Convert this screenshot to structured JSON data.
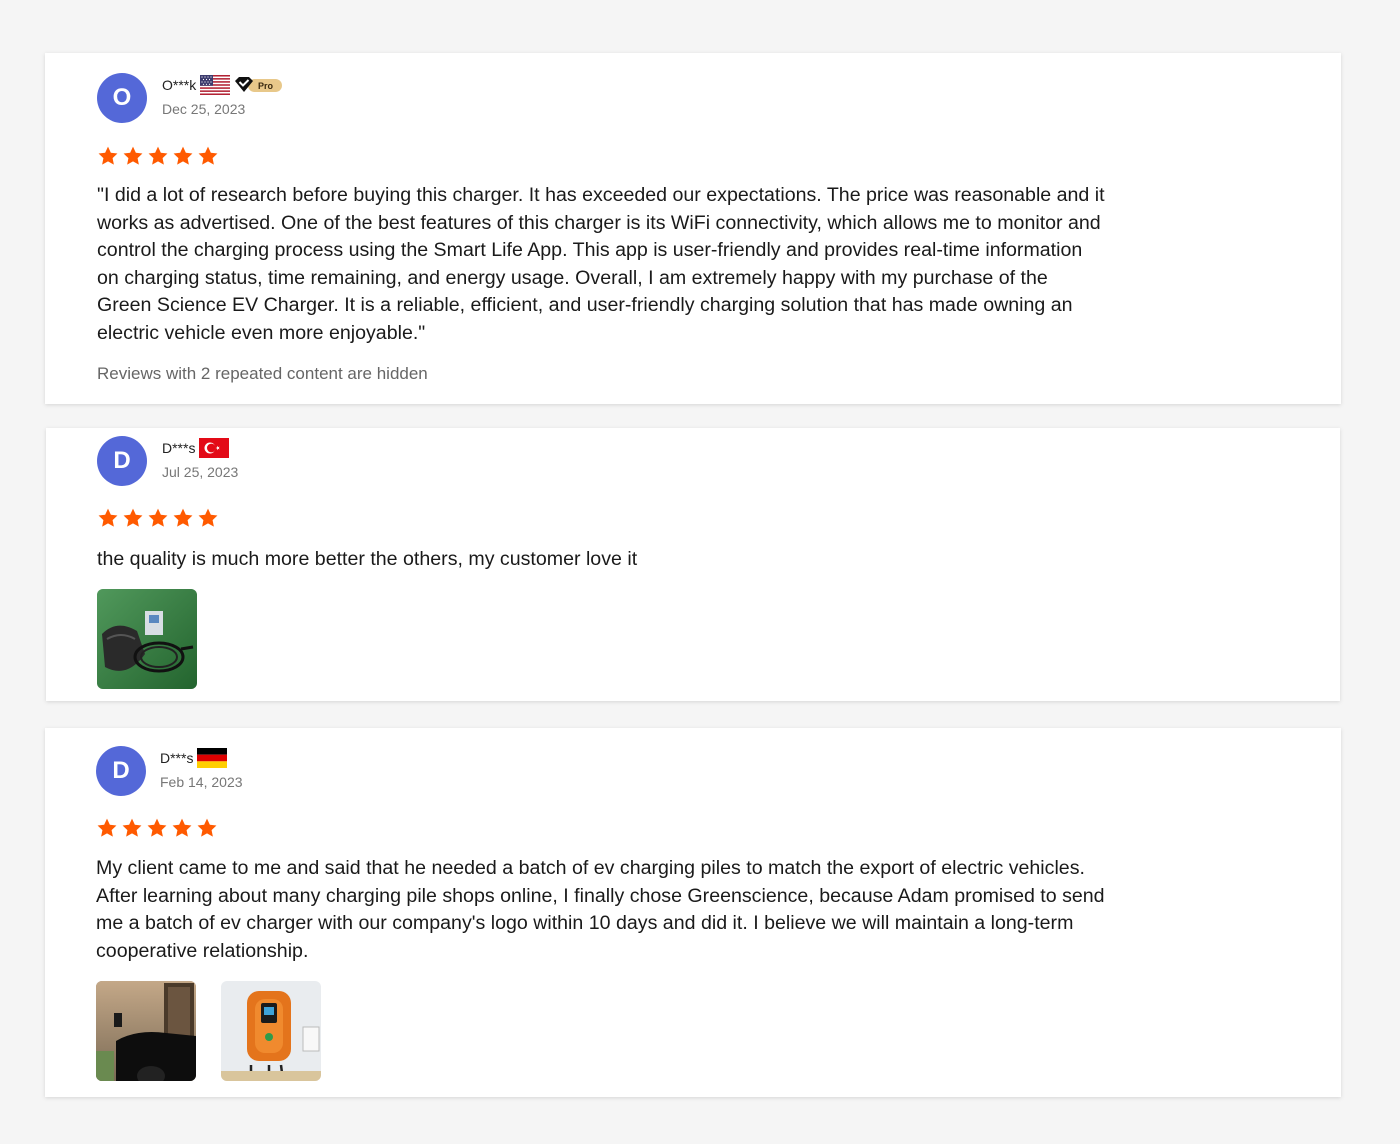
{
  "reviews": [
    {
      "initial": "O",
      "name": "O***k",
      "country_flag": "us-flag-icon",
      "badge": "Pro",
      "date": "Dec 25, 2023",
      "rating": 5,
      "text": "\"I did a lot of research before buying this charger. It has exceeded our expectations. The price was reasonable and it works as advertised. One of the best features of this charger is its WiFi connectivity, which allows me to monitor and control the charging process using the Smart Life App. This app is user-friendly and provides real-time information on charging status, time remaining, and energy usage. Overall, I am extremely happy with my purchase of the Green Science EV Charger. It is a reliable, efficient, and user-friendly charging solution that has made owning an electric vehicle even more enjoyable.\"",
      "hidden_note": "Reviews with 2 repeated content are hidden"
    },
    {
      "initial": "D",
      "name": "D***s",
      "country_flag": "turkey-flag-icon",
      "date": "Jul 25, 2023",
      "rating": 5,
      "text": "the quality is much more better the others, my customer love it",
      "photos": [
        "charger-package-photo"
      ]
    },
    {
      "initial": "D",
      "name": "D***s",
      "country_flag": "germany-flag-icon",
      "date": "Feb 14, 2023",
      "rating": 5,
      "text": "My client came to me and said that he needed a batch of ev charging piles to match the export of electric vehicles. After learning about many charging pile shops online, I finally chose Greenscience, because Adam promised to send me a batch of ev charger with our company's logo within 10 days and did it. I believe we will maintain a long-term cooperative relationship.",
      "photos": [
        "wall-charger-car-photo",
        "orange-charger-photo"
      ]
    }
  ],
  "colors": {
    "avatar": "#5468d8",
    "star": "#ff5a00",
    "background": "#f5f5f5"
  }
}
